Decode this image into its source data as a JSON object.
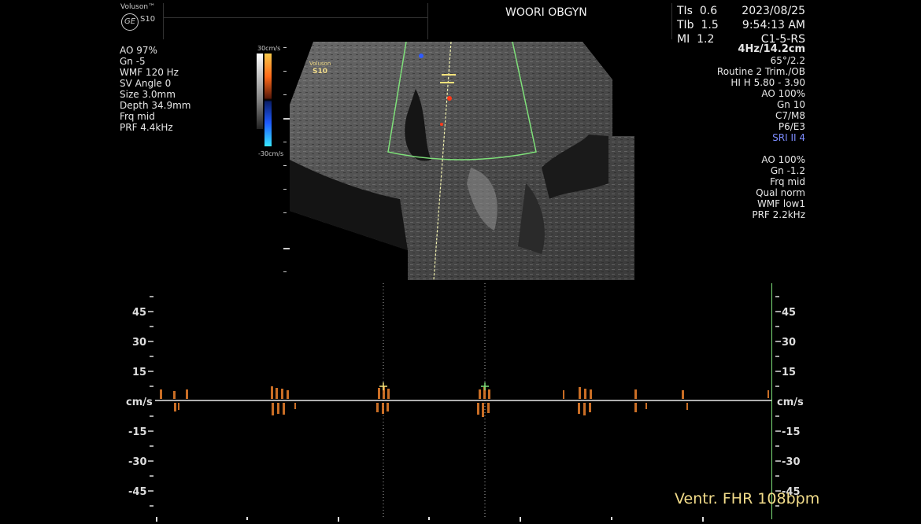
{
  "header": {
    "brand": "Voluson™",
    "model": "S10",
    "institution": "WOORI OBGYN",
    "tls": [
      "TIs",
      "0.6"
    ],
    "tlb": [
      "TIb",
      "1.5"
    ],
    "mi": [
      "MI",
      "1.2"
    ],
    "date": "2023/08/25",
    "time": "9:54:13 AM",
    "probe": "C1-5-RS"
  },
  "left_params": [
    "AO 97%",
    "Gn  -5",
    "WMF 120 Hz",
    "SV Angle  0",
    "Size  3.0mm",
    "Depth 34.9mm",
    "Frq mid",
    "PRF  4.4kHz"
  ],
  "color_scale": {
    "top": "30cm/s",
    "bottom": "-30cm/s"
  },
  "image_badge": {
    "brand": "Voluson",
    "model": "S10"
  },
  "right_params": {
    "freq_depth": "4Hz/14.2cm",
    "lines": [
      "65°/2.2",
      "Routine 2 Trim./OB",
      "HI H  5.80 - 3.90",
      "AO 100%",
      "Gn  10",
      "C7/M8",
      "P6/E3"
    ],
    "sri": "SRI II 4",
    "lines2": [
      "AO 100%",
      "Gn  -1.2",
      "Frq mid",
      "Qual norm",
      "WMF low1",
      "PRF  2.2kHz"
    ]
  },
  "doppler": {
    "unit": "cm/s",
    "ticks": [
      "45",
      "30",
      "15",
      "-15",
      "-30",
      "-45"
    ],
    "measurement": "Ventr. FHR 108bpm"
  },
  "colors": {
    "accent": "#f2dc8a",
    "sri": "#7c8cff",
    "gate": "#7fe07a"
  }
}
